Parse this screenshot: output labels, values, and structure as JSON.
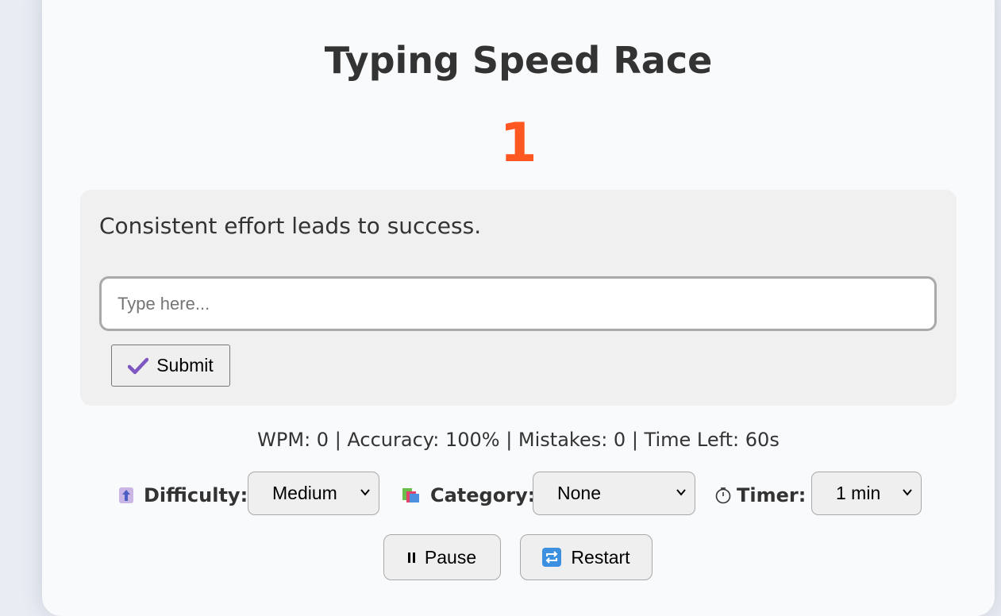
{
  "app": {
    "title": "Typing Speed Race",
    "countdown": "1"
  },
  "race": {
    "sentence": "Consistent effort leads to success.",
    "input_value": "",
    "input_placeholder": "Type here...",
    "submit_label": "Submit"
  },
  "stats": {
    "text": "WPM: 0 | Accuracy: 100% | Mistakes: 0 | Time Left: 60s"
  },
  "controls": {
    "difficulty_label": "Difficulty:",
    "difficulty_value": "Medium",
    "category_label": "Category:",
    "category_value": "None",
    "timer_label": "Timer:",
    "timer_value": "1 min"
  },
  "actions": {
    "pause_label": "Pause",
    "restart_label": "Restart"
  },
  "icons": {
    "difficulty": "up-arrow-icon",
    "category": "books-icon",
    "timer": "stopwatch-icon",
    "submit": "check-mark-icon",
    "pause": "pause-icon",
    "restart": "repeat-icon"
  },
  "colors": {
    "countdown": "#ff5722",
    "panel_background": "#f0f0f0",
    "page_background": "#e9ecf3"
  }
}
